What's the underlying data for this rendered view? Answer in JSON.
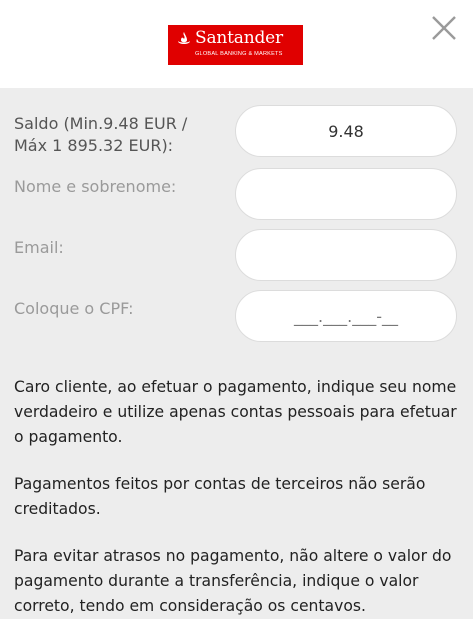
{
  "header": {
    "logo": {
      "brand": "Santander",
      "tagline": "GLOBAL BANKING & MARKETS",
      "brand_color": "#e00000"
    },
    "close_icon": "close-icon"
  },
  "form": {
    "saldo": {
      "label_line1": "Saldo (Min.9.48 EUR /",
      "label_line2": "Máx 1 895.32 EUR):",
      "value": "9.48"
    },
    "name": {
      "label": "Nome e sobrenome:",
      "value": ""
    },
    "email": {
      "label": "Email:",
      "value": ""
    },
    "cpf": {
      "label": "Coloque o CPF:",
      "placeholder": "___.___.___-__"
    }
  },
  "info": {
    "p1": "Caro cliente, ao efetuar o pagamento, indique seu nome verdadeiro e utilize apenas contas pessoais para efetuar o pagamento.",
    "p2": "Pagamentos feitos por contas de terceiros não serão creditados.",
    "p3": "Para evitar atrasos no pagamento, não altere o valor do pagamento durante a transferência, indique o valor correto, tendo em consideração os centavos."
  }
}
